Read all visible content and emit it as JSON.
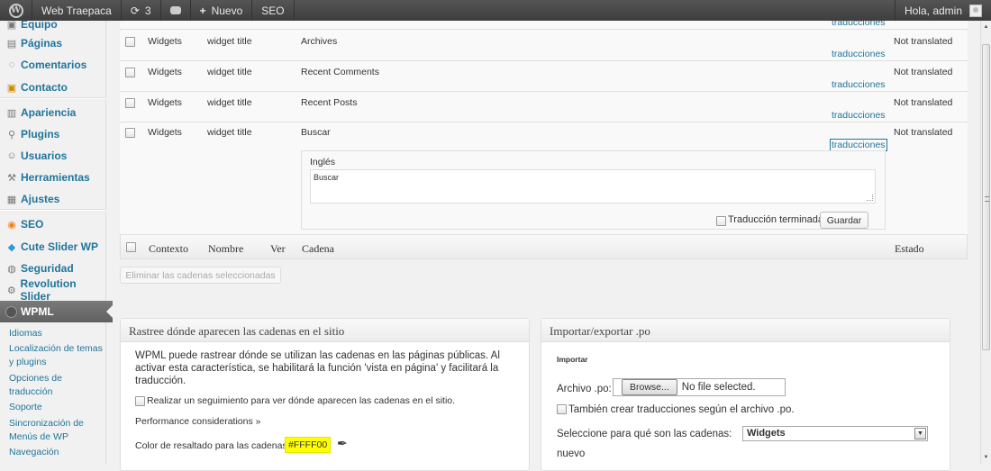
{
  "adminbar": {
    "site_name": "Web Traepaca",
    "updates_count": "3",
    "new_label": "Nuevo",
    "seo_label": "SEO",
    "greeting": "Hola, admin"
  },
  "sidebar": {
    "items": [
      {
        "label": "Equipo",
        "icon": "team-icon"
      },
      {
        "label": "Páginas",
        "icon": "pages-icon"
      },
      {
        "label": "Comentarios",
        "icon": "comments-icon"
      },
      {
        "label": "Contacto",
        "icon": "contact-icon"
      },
      {
        "label": "Apariencia",
        "icon": "appearance-icon"
      },
      {
        "label": "Plugins",
        "icon": "plugins-icon"
      },
      {
        "label": "Usuarios",
        "icon": "users-icon"
      },
      {
        "label": "Herramientas",
        "icon": "tools-icon"
      },
      {
        "label": "Ajustes",
        "icon": "settings-icon"
      },
      {
        "label": "SEO",
        "icon": "seo-icon"
      },
      {
        "label": "Cute Slider WP",
        "icon": "slider-icon"
      },
      {
        "label": "Seguridad",
        "icon": "security-icon"
      },
      {
        "label": "Revolution Slider",
        "icon": "revolution-icon"
      }
    ],
    "active": {
      "label": "WPML",
      "icon": "wpml-icon"
    },
    "submenu": [
      "Idiomas",
      "Localización de temas y plugins",
      "Opciones de traducción",
      "Soporte",
      "Sincronización de Menús de WP",
      "Navegación"
    ]
  },
  "strings_table": {
    "top_link": "traducciones",
    "rows": [
      {
        "context": "Widgets",
        "name": "widget title",
        "string": "Archives",
        "status": "Not translated",
        "link": "traducciones"
      },
      {
        "context": "Widgets",
        "name": "widget title",
        "string": "Recent Comments",
        "status": "Not translated",
        "link": "traducciones"
      },
      {
        "context": "Widgets",
        "name": "widget title",
        "string": "Recent Posts",
        "status": "Not translated",
        "link": "traducciones"
      },
      {
        "context": "Widgets",
        "name": "widget title",
        "string": "Buscar",
        "status": "Not translated",
        "link": "traducciones"
      }
    ],
    "translation": {
      "language": "Inglés",
      "value": "Buscar",
      "finished_label": "Traducción terminada",
      "save_label": "Guardar"
    },
    "footer": {
      "context": "Contexto",
      "name": "Nombre",
      "view": "Ver",
      "string": "Cadena",
      "status": "Estado"
    },
    "delete_button": "Eliminar las cadenas seleccionadas"
  },
  "track_box": {
    "title": "Rastree dónde aparecen las cadenas en el sitio",
    "description": "WPML puede rastrear dónde se utilizan las cadenas en las páginas públicas. Al activar esta característica, se habilitará la función 'vista en página' y facilitará la traducción.",
    "checkbox_label": "Realizar un seguimiento para ver dónde aparecen las cadenas en el sitio.",
    "performance_link": "Performance considerations »",
    "highlight_label": "Color de resaltado para las cadenas",
    "highlight_value": "#FFFF00",
    "highlight_color": "#ffff00"
  },
  "import_box": {
    "title": "Importar/exportar .po",
    "section_label": "Importar",
    "file_label": "Archivo .po:",
    "browse_label": "Browse...",
    "file_status": "No file selected.",
    "create_checkbox_label": "También crear traducciones según el archivo .po.",
    "select_label": "Seleccione para qué son las cadenas:",
    "select_value": "Widgets",
    "new_link": "nuevo"
  }
}
